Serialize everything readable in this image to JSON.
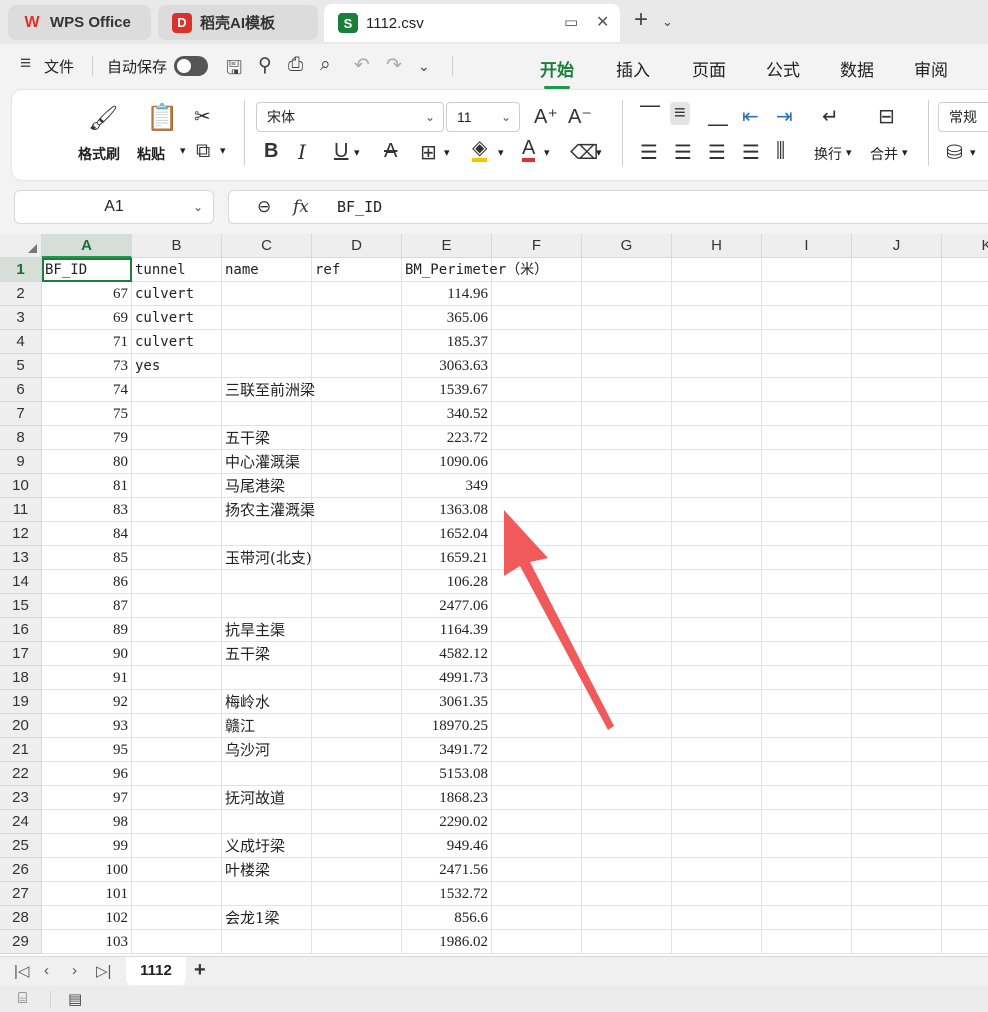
{
  "tabs": [
    {
      "label": "WPS Office",
      "icon": "W"
    },
    {
      "label": "稻壳AI模板",
      "icon": "D"
    },
    {
      "label": "1112.csv",
      "icon": "S"
    }
  ],
  "menu": {
    "file_label": "文件",
    "autosave_label": "自动保存",
    "ribbon_tabs": [
      "开始",
      "插入",
      "页面",
      "公式",
      "数据",
      "审阅"
    ]
  },
  "ribbon": {
    "format_painter": "格式刷",
    "paste": "粘贴",
    "font_name": "宋体",
    "font_size": "11",
    "wrap": "换行",
    "merge": "合并",
    "number_format": "常规"
  },
  "formula_bar": {
    "cell_ref": "A1",
    "fx": "fx",
    "value": "BF_ID"
  },
  "columns": [
    "A",
    "B",
    "C",
    "D",
    "E",
    "F",
    "G",
    "H",
    "I",
    "J",
    "K"
  ],
  "header_row": [
    "BF_ID",
    "tunnel",
    "name",
    "ref",
    "BM_Perimeter（米）"
  ],
  "rows": [
    {
      "n": "2",
      "id": "67",
      "tunnel": "culvert",
      "name": "",
      "ref": "",
      "perim": "114.96"
    },
    {
      "n": "3",
      "id": "69",
      "tunnel": "culvert",
      "name": "",
      "ref": "",
      "perim": "365.06"
    },
    {
      "n": "4",
      "id": "71",
      "tunnel": "culvert",
      "name": "",
      "ref": "",
      "perim": "185.37"
    },
    {
      "n": "5",
      "id": "73",
      "tunnel": "yes",
      "name": "",
      "ref": "",
      "perim": "3063.63"
    },
    {
      "n": "6",
      "id": "74",
      "tunnel": "",
      "name": "三联至前洲梁",
      "ref": "",
      "perim": "1539.67"
    },
    {
      "n": "7",
      "id": "75",
      "tunnel": "",
      "name": "",
      "ref": "",
      "perim": "340.52"
    },
    {
      "n": "8",
      "id": "79",
      "tunnel": "",
      "name": "五干梁",
      "ref": "",
      "perim": "223.72"
    },
    {
      "n": "9",
      "id": "80",
      "tunnel": "",
      "name": "中心灌溉渠",
      "ref": "",
      "perim": "1090.06"
    },
    {
      "n": "10",
      "id": "81",
      "tunnel": "",
      "name": "马尾港梁",
      "ref": "",
      "perim": "349"
    },
    {
      "n": "11",
      "id": "83",
      "tunnel": "",
      "name": "扬农主灌溉渠",
      "ref": "",
      "perim": "1363.08"
    },
    {
      "n": "12",
      "id": "84",
      "tunnel": "",
      "name": "",
      "ref": "",
      "perim": "1652.04"
    },
    {
      "n": "13",
      "id": "85",
      "tunnel": "",
      "name": "玉带河(北支)",
      "ref": "",
      "perim": "1659.21"
    },
    {
      "n": "14",
      "id": "86",
      "tunnel": "",
      "name": "",
      "ref": "",
      "perim": "106.28"
    },
    {
      "n": "15",
      "id": "87",
      "tunnel": "",
      "name": "",
      "ref": "",
      "perim": "2477.06"
    },
    {
      "n": "16",
      "id": "89",
      "tunnel": "",
      "name": "抗旱主渠",
      "ref": "",
      "perim": "1164.39"
    },
    {
      "n": "17",
      "id": "90",
      "tunnel": "",
      "name": "五干梁",
      "ref": "",
      "perim": "4582.12"
    },
    {
      "n": "18",
      "id": "91",
      "tunnel": "",
      "name": "",
      "ref": "",
      "perim": "4991.73"
    },
    {
      "n": "19",
      "id": "92",
      "tunnel": "",
      "name": "梅岭水",
      "ref": "",
      "perim": "3061.35"
    },
    {
      "n": "20",
      "id": "93",
      "tunnel": "",
      "name": "赣江",
      "ref": "",
      "perim": "18970.25"
    },
    {
      "n": "21",
      "id": "95",
      "tunnel": "",
      "name": "乌沙河",
      "ref": "",
      "perim": "3491.72"
    },
    {
      "n": "22",
      "id": "96",
      "tunnel": "",
      "name": "",
      "ref": "",
      "perim": "5153.08"
    },
    {
      "n": "23",
      "id": "97",
      "tunnel": "",
      "name": "抚河故道",
      "ref": "",
      "perim": "1868.23"
    },
    {
      "n": "24",
      "id": "98",
      "tunnel": "",
      "name": "",
      "ref": "",
      "perim": "2290.02"
    },
    {
      "n": "25",
      "id": "99",
      "tunnel": "",
      "name": "义成圩梁",
      "ref": "",
      "perim": "949.46"
    },
    {
      "n": "26",
      "id": "100",
      "tunnel": "",
      "name": "叶楼梁",
      "ref": "",
      "perim": "2471.56"
    },
    {
      "n": "27",
      "id": "101",
      "tunnel": "",
      "name": "",
      "ref": "",
      "perim": "1532.72"
    },
    {
      "n": "28",
      "id": "102",
      "tunnel": "",
      "name": "会龙1梁",
      "ref": "",
      "perim": "856.6"
    },
    {
      "n": "29",
      "id": "103",
      "tunnel": "",
      "name": "",
      "ref": "",
      "perim": "1986.02"
    }
  ],
  "sheet": {
    "name": "1112"
  },
  "colors": {
    "accent": "#1a9a4a",
    "arrow": "#f05a5a"
  }
}
